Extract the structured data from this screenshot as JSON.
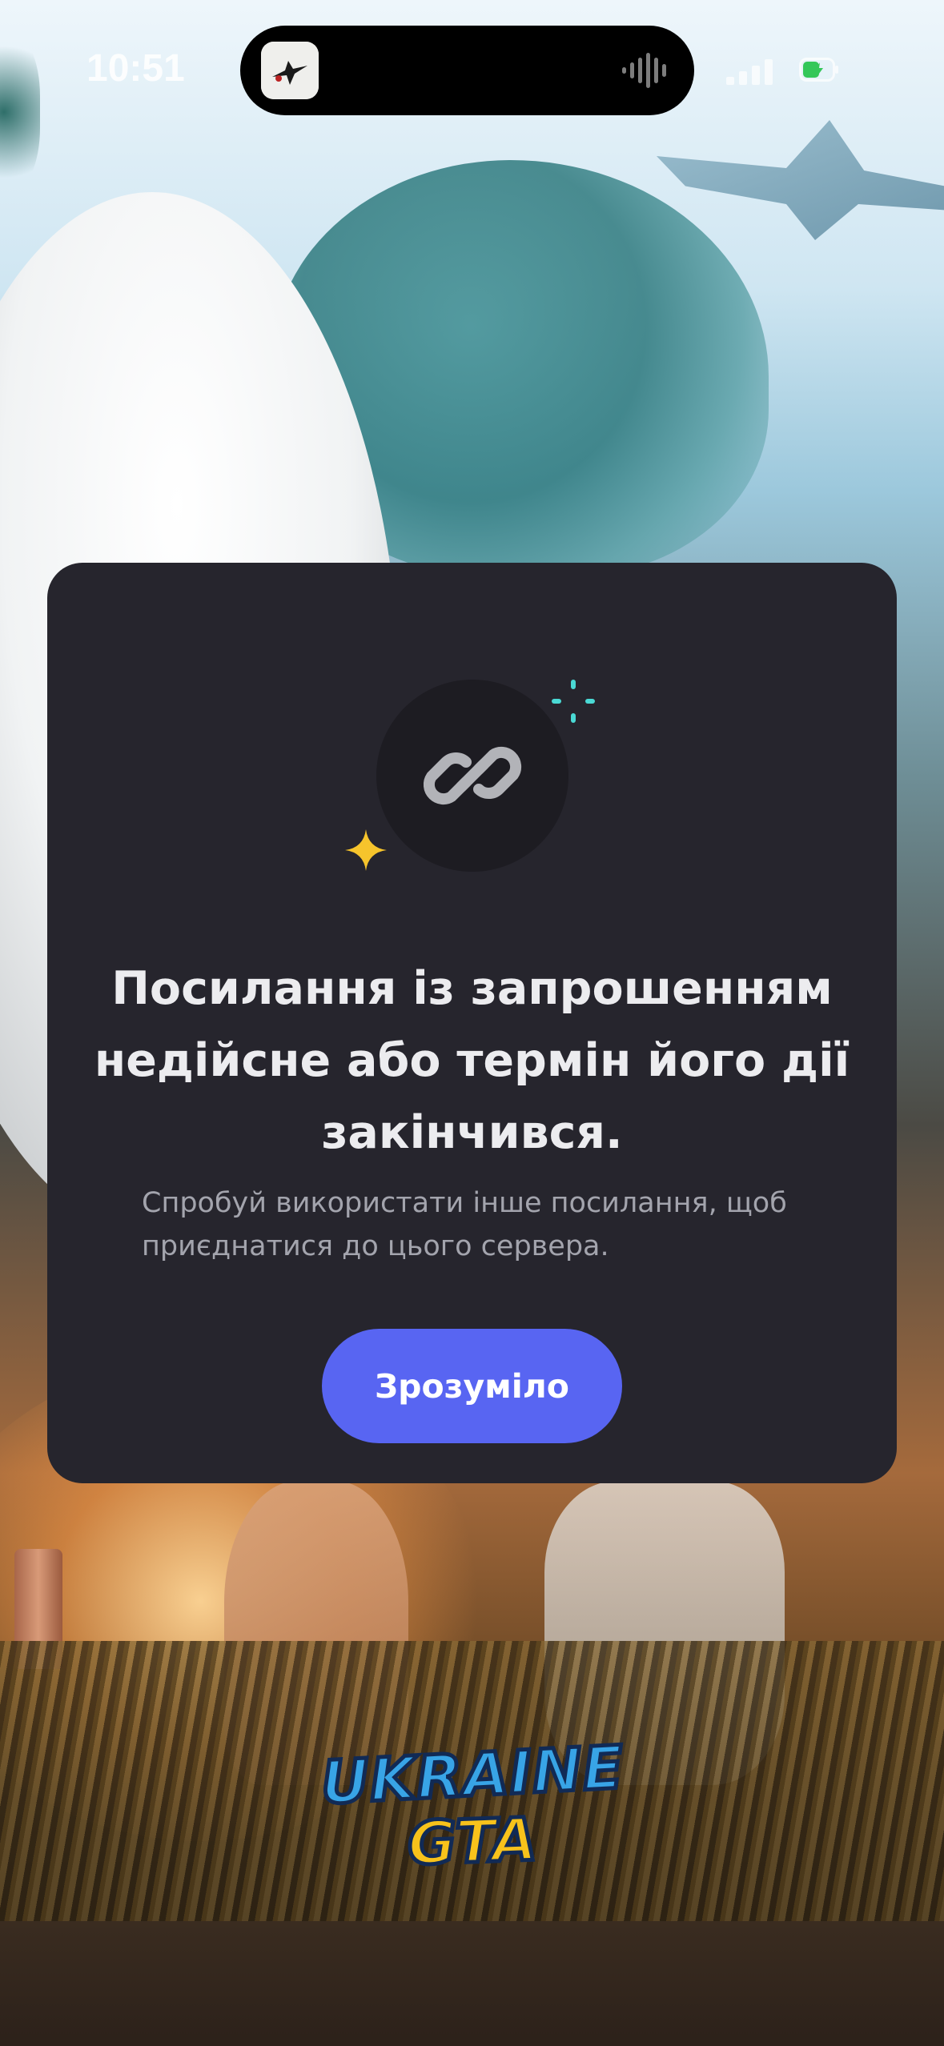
{
  "status_bar": {
    "time": "10:51"
  },
  "logo": {
    "line1": "UKRAINE",
    "line2": "GTA"
  },
  "dialog": {
    "icon": "link-icon",
    "title": "Посилання із запрошенням недійсне або термін його дії закінчився.",
    "message": "Спробуй використати інше посилання, щоб приєднатися до цього сервера.",
    "button_label": "Зрозуміло"
  },
  "colors": {
    "modal_bg": "#26252d",
    "button": "#5865f2",
    "sparkle_teal": "#4ad9d4",
    "sparkle_yellow": "#f6c42c",
    "battery": "#34c759"
  }
}
